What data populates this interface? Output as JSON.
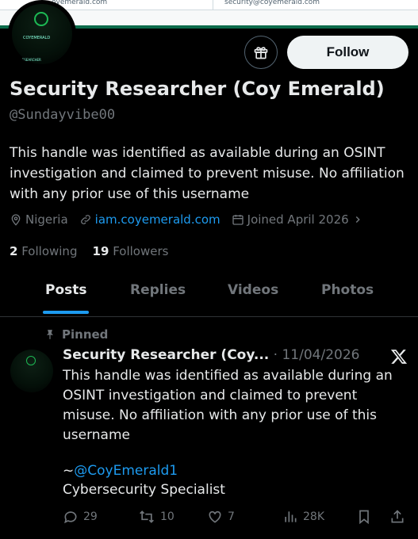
{
  "banner": {
    "left_email": "oyemerald.com",
    "right_email": "security@coyemerald.com"
  },
  "avatar": {
    "line1": "COYEMERALD",
    "line2": "RESEARCHER"
  },
  "header": {
    "follow_label": "Follow",
    "subscribe_icon": "subscribe-gift-icon"
  },
  "profile": {
    "name": "Security Researcher (Coy Emerald)",
    "handle": "@Sundayvibe00",
    "bio": "This handle was identified as available during an OSINT investigation and claimed to prevent misuse. No affiliation with any prior use of this username",
    "location": "Nigeria",
    "website": "iam.coyemerald.com",
    "joined": "Joined April 2026",
    "following_count": "2",
    "following_label": "Following",
    "followers_count": "19",
    "followers_label": "Followers"
  },
  "tabs": [
    {
      "label": "Posts"
    },
    {
      "label": "Replies"
    },
    {
      "label": "Videos"
    },
    {
      "label": "Photos"
    }
  ],
  "tweet": {
    "pinned_label": "Pinned",
    "author": "Security Researcher (Coy...",
    "date": "11/04/2026",
    "sep": "·",
    "text": "This handle was identified as available during an OSINT investigation and claimed to prevent misuse. No affiliation with any prior use of this username",
    "mention_prefix": "~",
    "mention": "@CoyEmerald1",
    "signature": "Cybersecurity Specialist",
    "replies": "29",
    "retweets": "10",
    "likes": "7",
    "views": "28K"
  },
  "colors": {
    "accent": "#1d9bf0",
    "muted": "#71767b",
    "text": "#e7e9ea",
    "background": "#000000"
  }
}
